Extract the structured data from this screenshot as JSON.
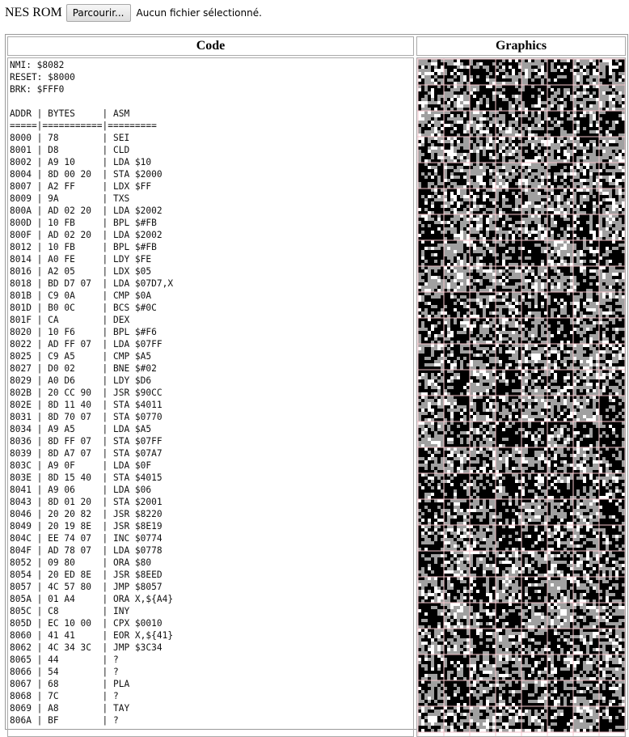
{
  "file_input": {
    "label": "NES ROM",
    "button": "Parcourir...",
    "status": "Aucun fichier sélectionné."
  },
  "headers": {
    "code": "Code",
    "graphics": "Graphics"
  },
  "vectors": [
    "NMI: $8082",
    "RESET: $8000",
    "BRK: $FFF0"
  ],
  "table_header": "ADDR | BYTES     | ASM",
  "table_rule": "=====|===========|=========",
  "rows": [
    "8000 | 78        | SEI",
    "8001 | D8        | CLD",
    "8002 | A9 10     | LDA $10",
    "8004 | 8D 00 20  | STA $2000",
    "8007 | A2 FF     | LDX $FF",
    "8009 | 9A        | TXS",
    "800A | AD 02 20  | LDA $2002",
    "800D | 10 FB     | BPL $#FB",
    "800F | AD 02 20  | LDA $2002",
    "8012 | 10 FB     | BPL $#FB",
    "8014 | A0 FE     | LDY $FE",
    "8016 | A2 05     | LDX $05",
    "8018 | BD D7 07  | LDA $07D7,X",
    "801B | C9 0A     | CMP $0A",
    "801D | B0 0C     | BCS $#0C",
    "801F | CA        | DEX",
    "8020 | 10 F6     | BPL $#F6",
    "8022 | AD FF 07  | LDA $07FF",
    "8025 | C9 A5     | CMP $A5",
    "8027 | D0 02     | BNE $#02",
    "8029 | A0 D6     | LDY $D6",
    "802B | 20 CC 90  | JSR $90CC",
    "802E | 8D 11 40  | STA $4011",
    "8031 | 8D 70 07  | STA $0770",
    "8034 | A9 A5     | LDA $A5",
    "8036 | 8D FF 07  | STA $07FF",
    "8039 | 8D A7 07  | STA $07A7",
    "803C | A9 0F     | LDA $0F",
    "803E | 8D 15 40  | STA $4015",
    "8041 | A9 06     | LDA $06",
    "8043 | 8D 01 20  | STA $2001",
    "8046 | 20 20 82  | JSR $8220",
    "8049 | 20 19 8E  | JSR $8E19",
    "804C | EE 74 07  | INC $0774",
    "804F | AD 78 07  | LDA $0778",
    "8052 | 09 80     | ORA $80",
    "8054 | 20 ED 8E  | JSR $8EED",
    "8057 | 4C 57 80  | JMP $8057",
    "805A | 01 A4     | ORA X,${A4}",
    "805C | C8        | INY",
    "805D | EC 10 00  | CPX $0010",
    "8060 | 41 41     | EOR X,${41}",
    "8062 | 4C 34 3C  | JMP $3C34",
    "8065 | 44        | ?",
    "8066 | 54        | ?",
    "8067 | 68        | PLA",
    "8068 | 7C        | ?",
    "8069 | A8        | TAY",
    "806A | BF        | ?"
  ],
  "graphics": {
    "columns": 8,
    "rows": 26,
    "palette": [
      "#000000",
      "#a0a0a0",
      "#ffffff"
    ],
    "grid_color": "#f4c6cc"
  }
}
